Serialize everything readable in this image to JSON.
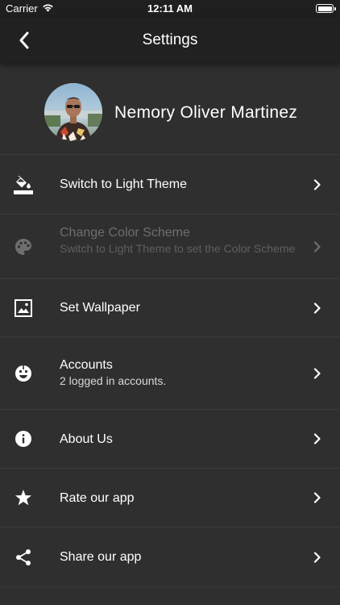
{
  "status_bar": {
    "carrier": "Carrier",
    "time": "12:11 AM"
  },
  "nav": {
    "title": "Settings"
  },
  "profile": {
    "name": "Nemory Oliver Martinez"
  },
  "menu": [
    {
      "label": "Switch to Light Theme",
      "subtitle": "",
      "icon": "paint-bucket-icon",
      "enabled": true
    },
    {
      "label": "Change Color Scheme",
      "subtitle": "Switch to Light Theme to set the Color Scheme",
      "icon": "palette-icon",
      "enabled": false
    },
    {
      "label": "Set Wallpaper",
      "subtitle": "",
      "icon": "wallpaper-icon",
      "enabled": true
    },
    {
      "label": "Accounts",
      "subtitle": "2 logged in accounts.",
      "icon": "accounts-face-icon",
      "enabled": true
    },
    {
      "label": "About Us",
      "subtitle": "",
      "icon": "info-icon",
      "enabled": true
    },
    {
      "label": "Rate our app",
      "subtitle": "",
      "icon": "star-icon",
      "enabled": true
    },
    {
      "label": "Share our app",
      "subtitle": "",
      "icon": "share-icon",
      "enabled": true
    }
  ],
  "colors": {
    "background": "#2f2f2f",
    "nav_background": "#212121",
    "text": "#ffffff",
    "disabled_text": "#6e6e6e",
    "divider": "#3b3b3b"
  }
}
